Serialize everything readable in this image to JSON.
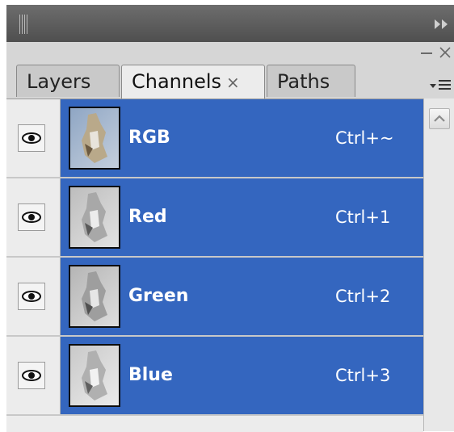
{
  "panel": {
    "tabs": [
      {
        "label": "Layers",
        "active": false
      },
      {
        "label": "Channels",
        "active": true,
        "close_glyph": "×"
      },
      {
        "label": "Paths",
        "active": false
      }
    ],
    "window_controls": {
      "minimize": "–",
      "close": "×"
    },
    "menu_icon": "panel-menu-icon",
    "collapse_icon": "double-arrow-right-icon"
  },
  "channels": [
    {
      "name": "RGB",
      "shortcut": "Ctrl+~",
      "visible": true,
      "selected": true
    },
    {
      "name": "Red",
      "shortcut": "Ctrl+1",
      "visible": true,
      "selected": true
    },
    {
      "name": "Green",
      "shortcut": "Ctrl+2",
      "visible": true,
      "selected": true
    },
    {
      "name": "Blue",
      "shortcut": "Ctrl+3",
      "visible": true,
      "selected": true
    }
  ],
  "colors": {
    "selection": "#3466bf",
    "panel_bg": "#d6d6d6",
    "titlebar": "#5e5e5e"
  }
}
